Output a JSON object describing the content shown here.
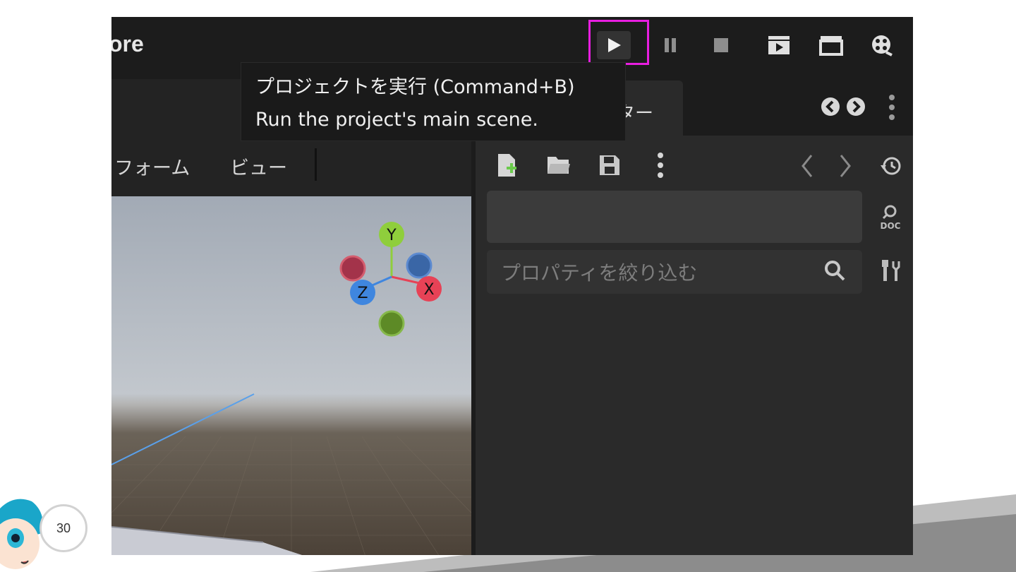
{
  "slide": {
    "page_number": "30"
  },
  "editor": {
    "app_title_fragment": "ore",
    "viewport_menu": [
      "フォーム",
      "ビュー"
    ],
    "inspector_tab_label": "ター",
    "filter_placeholder": "プロパティを絞り込む",
    "tooltip": {
      "title": "プロジェクトを実行 (Command+B)",
      "description": "Run the project's main scene."
    },
    "gizmo": {
      "x": "X",
      "y": "Y",
      "z": "Z"
    },
    "doc_icon_label": "DOC",
    "colors": {
      "highlight": "#e81ee0",
      "axis_x": "#e74256",
      "axis_y": "#8fce3c",
      "axis_z": "#3f86df"
    },
    "icons": {
      "toolbar": [
        "play-icon",
        "pause-icon",
        "stop-icon",
        "play-scene-icon",
        "play-custom-scene-icon",
        "movie-maker-icon"
      ],
      "inspector": [
        "new-resource-icon",
        "open-folder-icon",
        "save-icon",
        "more-vertical-icon",
        "back-icon",
        "forward-icon",
        "history-icon",
        "doc-search-icon",
        "tools-icon",
        "search-icon"
      ]
    }
  }
}
